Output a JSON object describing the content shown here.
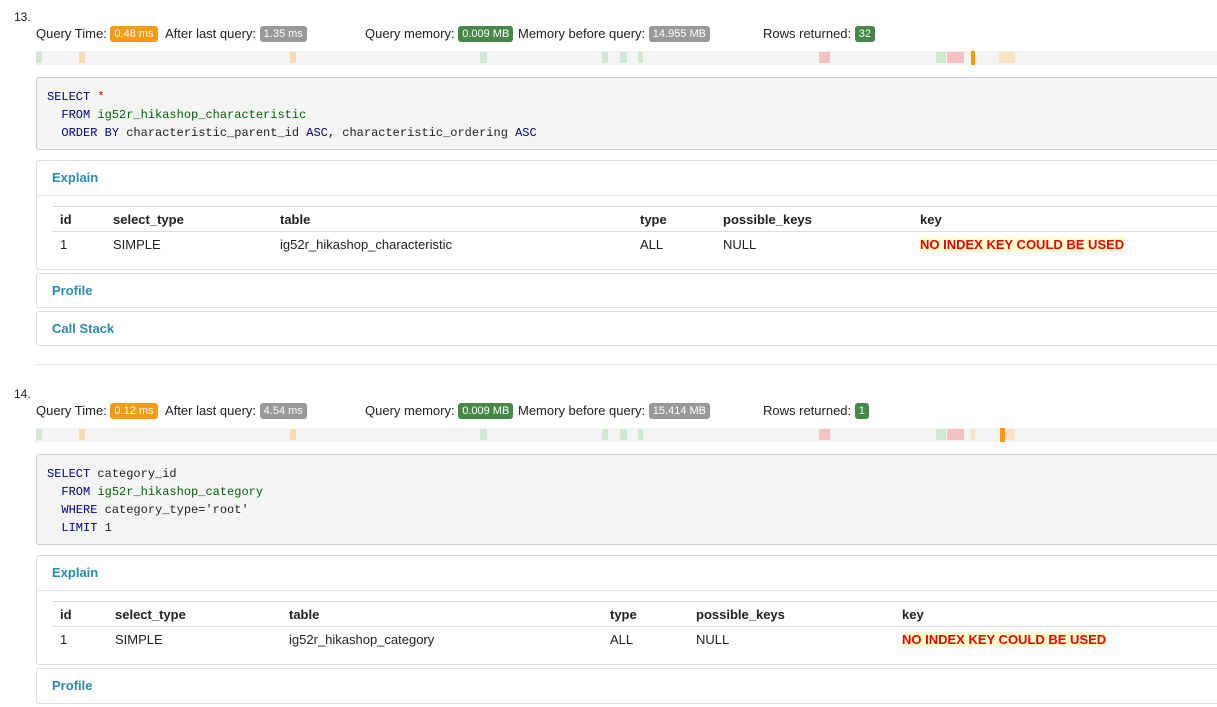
{
  "queries": [
    {
      "number": "13.",
      "query_time_label": "Query Time:",
      "query_time": "0.48 ms",
      "after_last_label": "After last query:",
      "after_last": "1.35 ms",
      "memory_label": "Query memory:",
      "memory": "0.009 MB",
      "mem_before_label": "Memory before query:",
      "mem_before": "14.955 MB",
      "rows_label": "Rows returned:",
      "rows": "32",
      "sql": {
        "l1_kw": "SELECT",
        "l1_rest": "*",
        "l2_kw": "FROM",
        "l2_tbl": "ig52r_hikashop_characteristic",
        "l3_kw": "ORDER BY",
        "l3_col1": "characteristic_parent_id",
        "l3_asc1": "ASC",
        "l3_comma": ",",
        "l3_col2": "characteristic_ordering",
        "l3_asc2": "ASC"
      },
      "explain_title": "Explain",
      "profile_title": "Profile",
      "callstack_title": "Call Stack",
      "row": {
        "id": "1",
        "select_type": "SIMPLE",
        "table": "ig52r_hikashop_characteristic",
        "type": "ALL",
        "possible_keys": "NULL",
        "key": "NO INDEX KEY COULD BE USED"
      }
    },
    {
      "number": "14.",
      "query_time_label": "Query Time:",
      "query_time": "0.12 ms",
      "after_last_label": "After last query:",
      "after_last": "4.54 ms",
      "memory_label": "Query memory:",
      "memory": "0.009 MB",
      "mem_before_label": "Memory before query:",
      "mem_before": "15.414 MB",
      "rows_label": "Rows returned:",
      "rows": "1",
      "sql": {
        "l1_kw": "SELECT",
        "l1_rest": "category_id",
        "l2_kw": "FROM",
        "l2_tbl": "ig52r_hikashop_category",
        "l3_kw": "WHERE",
        "l3_rest": "category_type=",
        "l3_str": "'root'",
        "l4_kw": "LIMIT",
        "l4_rest": "1"
      },
      "explain_title": "Explain",
      "profile_title": "Profile",
      "row": {
        "id": "1",
        "select_type": "SIMPLE",
        "table": "ig52r_hikashop_category",
        "type": "ALL",
        "possible_keys": "NULL",
        "key": "NO INDEX KEY COULD BE USED"
      }
    }
  ],
  "explain_headers": {
    "id": "id",
    "select_type": "select_type",
    "table": "table",
    "type": "type",
    "possible_keys": "possible_keys",
    "key": "key"
  },
  "colors": {
    "accent_link": "#2a8ab0",
    "badge_orange": "#f39c12",
    "badge_grey": "#999999",
    "badge_green": "#468847",
    "no_key_red": "#ee0000"
  }
}
